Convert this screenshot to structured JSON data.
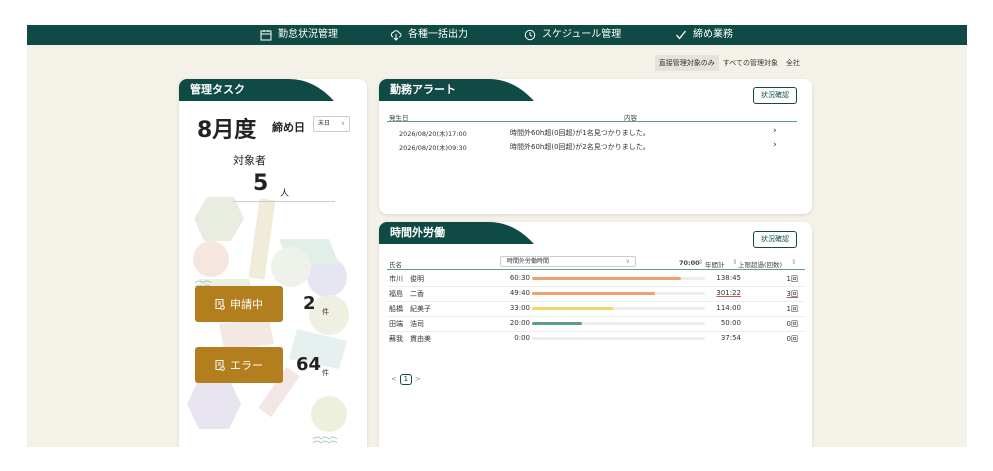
{
  "nav": {
    "items": [
      {
        "label": "勤怠状況管理",
        "icon": "calendar-icon"
      },
      {
        "label": "各種一括出力",
        "icon": "cloud-download-icon"
      },
      {
        "label": "スケジュール管理",
        "icon": "clock-icon"
      },
      {
        "label": "締め業務",
        "icon": "check-icon"
      }
    ]
  },
  "filters": [
    "直接管理対象のみ",
    "すべての管理対象",
    "全社"
  ],
  "task": {
    "title": "管理タスク",
    "month": "8月度",
    "closing_label": "締め日",
    "closing_value": "末日",
    "target_label": "対象者",
    "target_count": "5",
    "target_unit": "人",
    "pending_label": "申請中",
    "pending_count": "2",
    "pending_unit": "件",
    "error_label": "エラー",
    "error_count": "64",
    "error_unit": "件"
  },
  "alert": {
    "title": "勤務アラート",
    "button": "状況確認",
    "col_date": "発生日",
    "col_content": "内容",
    "rows": [
      {
        "date": "2026/08/20(木)17:00",
        "content": "時間外60h超(0回超)が1名見つかりました。"
      },
      {
        "date": "2026/08/20(木)09:30",
        "content": "時間外60h超(0回超)が2名見つかりました。"
      }
    ]
  },
  "overtime": {
    "title": "時間外労働",
    "button": "状況確認",
    "col_name": "氏名",
    "select_label": "時間外労働時間",
    "threshold": "70:00",
    "col_year": "年間計",
    "col_limit": "上限超過(回数)",
    "rows": [
      {
        "name": "市川　俊明",
        "hours": "60:30",
        "progress": 0.86,
        "color": "#f0a070",
        "year": "138:45",
        "count": "1回",
        "year_link": false
      },
      {
        "name": "福島　二香",
        "hours": "49:40",
        "progress": 0.71,
        "color": "#f0a070",
        "year": "301:22",
        "count": "3回",
        "year_link": true
      },
      {
        "name": "船橋　紀美子",
        "hours": "33:00",
        "progress": 0.47,
        "color": "#f3d56e",
        "year": "114:00",
        "count": "1回",
        "year_link": false
      },
      {
        "name": "田端　浩司",
        "hours": "20:00",
        "progress": 0.29,
        "color": "#5aa084",
        "year": "50:00",
        "count": "0回",
        "year_link": false
      },
      {
        "name": "蘇我　貫由美",
        "hours": "0:00",
        "progress": 0.0,
        "color": "#5aa084",
        "year": "37:54",
        "count": "0回",
        "year_link": false
      }
    ],
    "pagination": {
      "prev": "<",
      "current": "1",
      "next": ">"
    }
  },
  "colors": {
    "brand": "#0f4a44",
    "gold": "#b37f1e",
    "background": "#f4f2e8"
  }
}
